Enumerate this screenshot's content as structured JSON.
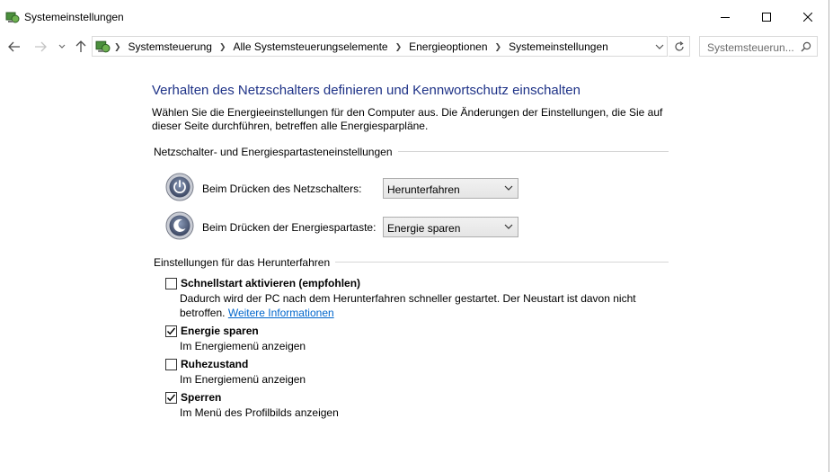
{
  "window": {
    "title": "Systemeinstellungen",
    "min_icon": "minimize-icon",
    "max_icon": "maximize-icon",
    "close_icon": "close-icon"
  },
  "address": {
    "breadcrumbs": [
      "Systemsteuerung",
      "Alle Systemsteuerungselemente",
      "Energieoptionen",
      "Systemeinstellungen"
    ],
    "search_placeholder": "Systemsteuerun..."
  },
  "page": {
    "heading": "Verhalten des Netzschalters definieren und Kennwortschutz einschalten",
    "intro": "Wählen Sie die Energieeinstellungen für den Computer aus. Die Änderungen der Einstellungen, die Sie auf dieser Seite durchführen, betreffen alle Energiesparpläne."
  },
  "power_section": {
    "label": "Netzschalter- und Energiespartasteneinstellungen",
    "rows": [
      {
        "label": "Beim Drücken des Netzschalters:",
        "value": "Herunterfahren",
        "icon": "power-button-icon"
      },
      {
        "label": "Beim Drücken der Energiespartaste:",
        "value": "Energie sparen",
        "icon": "sleep-button-icon"
      }
    ]
  },
  "shutdown_section": {
    "label": "Einstellungen für das Herunterfahren",
    "options": [
      {
        "title": "Schnellstart aktivieren (empfohlen)",
        "checked": false,
        "desc": "Dadurch wird der PC nach dem Herunterfahren schneller gestartet. Der Neustart ist davon nicht betroffen.",
        "link": "Weitere Informationen"
      },
      {
        "title": "Energie sparen",
        "checked": true,
        "desc": "Im Energiemenü anzeigen"
      },
      {
        "title": "Ruhezustand",
        "checked": false,
        "desc": "Im Energiemenü anzeigen"
      },
      {
        "title": "Sperren",
        "checked": true,
        "desc": "Im Menü des Profilbilds anzeigen"
      }
    ]
  },
  "colors": {
    "heading": "#1e3287",
    "link": "#0066cc"
  }
}
